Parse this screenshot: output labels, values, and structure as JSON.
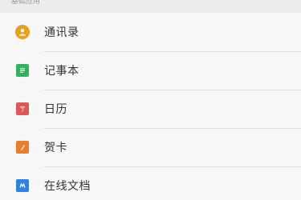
{
  "section": {
    "title": "基础应用"
  },
  "colors": {
    "contacts": "#e8a21a",
    "notes": "#2fb35b",
    "calendar": "#e05757",
    "cards": "#ee7d2a",
    "docs": "#2c82e6"
  },
  "apps": [
    {
      "label": "通讯录",
      "icon": "contacts-icon"
    },
    {
      "label": "记事本",
      "icon": "notebook-icon"
    },
    {
      "label": "日历",
      "icon": "calendar-icon"
    },
    {
      "label": "贺卡",
      "icon": "greeting-card-icon"
    },
    {
      "label": "在线文档",
      "icon": "online-doc-icon"
    }
  ]
}
